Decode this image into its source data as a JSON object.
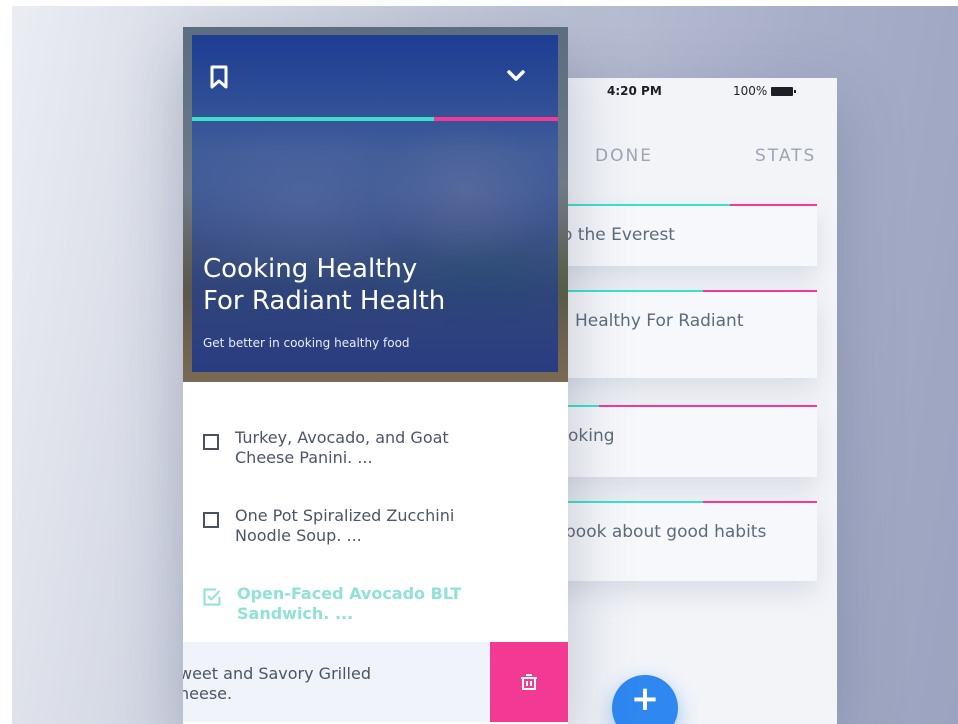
{
  "status_bar": {
    "time": "4:20 PM",
    "battery": "100%"
  },
  "tabs": [
    {
      "label": "DONE"
    },
    {
      "label": "STATS"
    }
  ],
  "tasks": [
    {
      "text": "o the Everest",
      "progress_teal": 0.68
    },
    {
      "text": "Healthy For Radiant",
      "progress_teal": 0.58
    },
    {
      "text": "oking",
      "progress_teal": 0.2
    },
    {
      "text": "book about good habits",
      "progress_teal": 0.58
    }
  ],
  "fab": {
    "label": "+"
  },
  "card": {
    "title_line1": "Cooking Healthy",
    "title_line2": "For Radiant Health",
    "subtitle": "Get better in cooking healthy food",
    "progress": 0.66
  },
  "todos": [
    {
      "line1": "Turkey, Avocado, and Goat",
      "line2": "Cheese Panini. ...",
      "done": false
    },
    {
      "line1": "One Pot Spiralized Zucchini",
      "line2": "Noodle Soup. ...",
      "done": false
    },
    {
      "line1": "Open-Faced Avocado BLT",
      "line2": "Sandwich. ...",
      "done": true
    }
  ],
  "swipe_item": {
    "line1": "weet and Savory Grilled",
    "line2": "heese."
  },
  "icons": {
    "bookmark": "bookmark-icon",
    "chevron": "chevron-down-icon",
    "delete": "trash-icon",
    "checkbox": "checkbox-icon",
    "checked": "checkbox-checked-icon"
  },
  "colors": {
    "teal": "#3ee0cb",
    "pink": "#f23a92",
    "fab": "#2f87f0",
    "done_text": "#8fe2d5"
  }
}
